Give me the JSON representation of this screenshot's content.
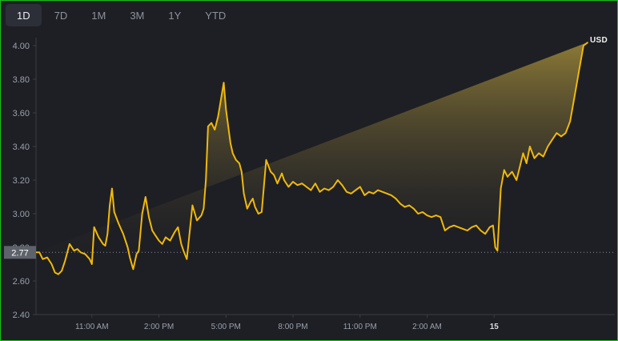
{
  "tabs": [
    {
      "label": "1D",
      "active": true
    },
    {
      "label": "7D",
      "active": false
    },
    {
      "label": "1M",
      "active": false
    },
    {
      "label": "3M",
      "active": false
    },
    {
      "label": "1Y",
      "active": false
    },
    {
      "label": "YTD",
      "active": false
    }
  ],
  "currency": "USD",
  "colors": {
    "line": "#f0b90b",
    "reference_box": "#5e626b",
    "axis": "#3a3d45"
  },
  "chart_data": {
    "type": "area",
    "ylim": [
      2.4,
      4.0
    ],
    "yticks": [
      "2.40",
      "2.60",
      "2.80",
      "3.00",
      "3.20",
      "3.40",
      "3.60",
      "3.80",
      "4.00"
    ],
    "xlim": [
      8.5,
      34.4
    ],
    "xticks": [
      {
        "value": 11,
        "label": "11:00 AM"
      },
      {
        "value": 14,
        "label": "2:00 PM"
      },
      {
        "value": 17,
        "label": "5:00 PM"
      },
      {
        "value": 20,
        "label": "8:00 PM"
      },
      {
        "value": 23,
        "label": "11:00 PM"
      },
      {
        "value": 26,
        "label": "2:00 AM"
      },
      {
        "value": 29,
        "label": "15",
        "bold": true
      }
    ],
    "reference": {
      "value": 2.77,
      "label": "2.77"
    },
    "x": [
      8.5,
      8.65,
      8.8,
      9.0,
      9.2,
      9.35,
      9.5,
      9.65,
      9.8,
      10.0,
      10.2,
      10.35,
      10.5,
      10.7,
      10.9,
      11.0,
      11.1,
      11.3,
      11.5,
      11.6,
      11.7,
      11.8,
      11.9,
      12.0,
      12.2,
      12.4,
      12.6,
      12.7,
      12.85,
      13.0,
      13.1,
      13.25,
      13.4,
      13.55,
      13.7,
      13.85,
      14.0,
      14.15,
      14.3,
      14.5,
      14.7,
      14.85,
      15.0,
      15.1,
      15.25,
      15.5,
      15.7,
      15.9,
      16.0,
      16.1,
      16.2,
      16.35,
      16.5,
      16.65,
      16.8,
      16.9,
      17.0,
      17.1,
      17.2,
      17.3,
      17.45,
      17.6,
      17.7,
      17.8,
      17.95,
      18.1,
      18.2,
      18.3,
      18.45,
      18.6,
      18.8,
      19.0,
      19.15,
      19.3,
      19.5,
      19.6,
      19.8,
      20.0,
      20.2,
      20.4,
      20.6,
      20.8,
      21.0,
      21.2,
      21.4,
      21.6,
      21.8,
      22.0,
      22.2,
      22.4,
      22.6,
      22.8,
      23.0,
      23.2,
      23.4,
      23.6,
      23.8,
      24.0,
      24.2,
      24.4,
      24.6,
      24.8,
      25.0,
      25.2,
      25.4,
      25.6,
      25.8,
      26.0,
      26.2,
      26.4,
      26.6,
      26.8,
      27.0,
      27.2,
      27.4,
      27.6,
      27.8,
      28.0,
      28.2,
      28.4,
      28.6,
      28.8,
      28.95,
      29.05,
      29.15,
      29.3,
      29.45,
      29.6,
      29.8,
      30.0,
      30.15,
      30.3,
      30.45,
      30.6,
      30.8,
      31.0,
      31.2,
      31.4,
      31.6,
      31.8,
      32.0,
      32.2,
      32.4,
      32.6,
      32.8,
      33.0,
      33.2,
      33.4,
      33.6,
      33.8,
      34.0,
      34.15,
      34.25,
      34.35,
      34.4
    ],
    "y": [
      2.77,
      2.77,
      2.73,
      2.74,
      2.7,
      2.65,
      2.64,
      2.66,
      2.72,
      2.82,
      2.78,
      2.79,
      2.77,
      2.76,
      2.73,
      2.7,
      2.92,
      2.86,
      2.82,
      2.81,
      2.88,
      3.05,
      3.15,
      3.01,
      2.94,
      2.88,
      2.8,
      2.74,
      2.67,
      2.76,
      2.78,
      3.0,
      3.1,
      2.98,
      2.9,
      2.87,
      2.84,
      2.82,
      2.86,
      2.84,
      2.89,
      2.92,
      2.82,
      2.78,
      2.73,
      3.05,
      2.96,
      2.99,
      3.03,
      3.2,
      3.52,
      3.54,
      3.5,
      3.58,
      3.7,
      3.78,
      3.62,
      3.52,
      3.42,
      3.36,
      3.32,
      3.3,
      3.25,
      3.12,
      3.03,
      3.07,
      3.09,
      3.04,
      3.0,
      3.01,
      3.32,
      3.25,
      3.23,
      3.18,
      3.24,
      3.2,
      3.16,
      3.19,
      3.17,
      3.18,
      3.16,
      3.14,
      3.18,
      3.13,
      3.15,
      3.14,
      3.16,
      3.2,
      3.17,
      3.13,
      3.12,
      3.14,
      3.16,
      3.11,
      3.13,
      3.12,
      3.14,
      3.13,
      3.12,
      3.11,
      3.09,
      3.06,
      3.04,
      3.05,
      3.03,
      3.0,
      3.01,
      2.99,
      2.98,
      2.99,
      2.98,
      2.9,
      2.92,
      2.93,
      2.92,
      2.91,
      2.9,
      2.92,
      2.93,
      2.9,
      2.88,
      2.92,
      2.93,
      2.8,
      2.78,
      3.15,
      3.26,
      3.22,
      3.25,
      3.2,
      3.28,
      3.36,
      3.3,
      3.4,
      3.33,
      3.36,
      3.34,
      3.4,
      3.44,
      3.48,
      3.46,
      3.48,
      3.55,
      3.7,
      3.85,
      4.0,
      4.02
    ]
  }
}
